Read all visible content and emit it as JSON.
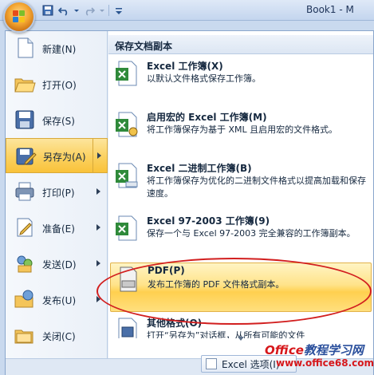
{
  "titlebar": {
    "title": "Book1 - M"
  },
  "left_menu": {
    "items": [
      {
        "label": "新建(N)",
        "has_arrow": false
      },
      {
        "label": "打开(O)",
        "has_arrow": false
      },
      {
        "label": "保存(S)",
        "has_arrow": false
      },
      {
        "label": "另存为(A)",
        "has_arrow": true,
        "selected": true
      },
      {
        "label": "打印(P)",
        "has_arrow": true
      },
      {
        "label": "准备(E)",
        "has_arrow": true
      },
      {
        "label": "发送(D)",
        "has_arrow": true
      },
      {
        "label": "发布(U)",
        "has_arrow": true
      },
      {
        "label": "关闭(C)",
        "has_arrow": false
      }
    ]
  },
  "right_panel": {
    "header": "保存文档副本",
    "options": [
      {
        "title": "Excel 工作簿(X)",
        "desc": "以默认文件格式保存工作簿。"
      },
      {
        "title": "启用宏的 Excel 工作簿(M)",
        "desc": "将工作簿保存为基于 XML 且启用宏的文件格式。"
      },
      {
        "title": "Excel 二进制工作簿(B)",
        "desc": "将工作簿保存为优化的二进制文件格式以提高加载和保存速度。"
      },
      {
        "title": "Excel 97-2003 工作簿(9)",
        "desc": "保存一个与 Excel 97-2003 完全兼容的工作簿副本。"
      },
      {
        "title": "PDF(P)",
        "desc": "发布工作簿的 PDF 文件格式副本。",
        "selected": true
      },
      {
        "title": "其他格式(O)",
        "desc": "打开“另存为”对话框，从所有可能的文件"
      }
    ]
  },
  "bottom": {
    "options_button": "Excel 选项(I)"
  },
  "watermark": {
    "brand_a": "Office",
    "brand_b": "教程学习网",
    "url": "www.office68.com"
  },
  "colors": {
    "accent_selected": "#fbd160",
    "annotation": "#d21f1f",
    "excel_green": "#2f8a3a"
  }
}
